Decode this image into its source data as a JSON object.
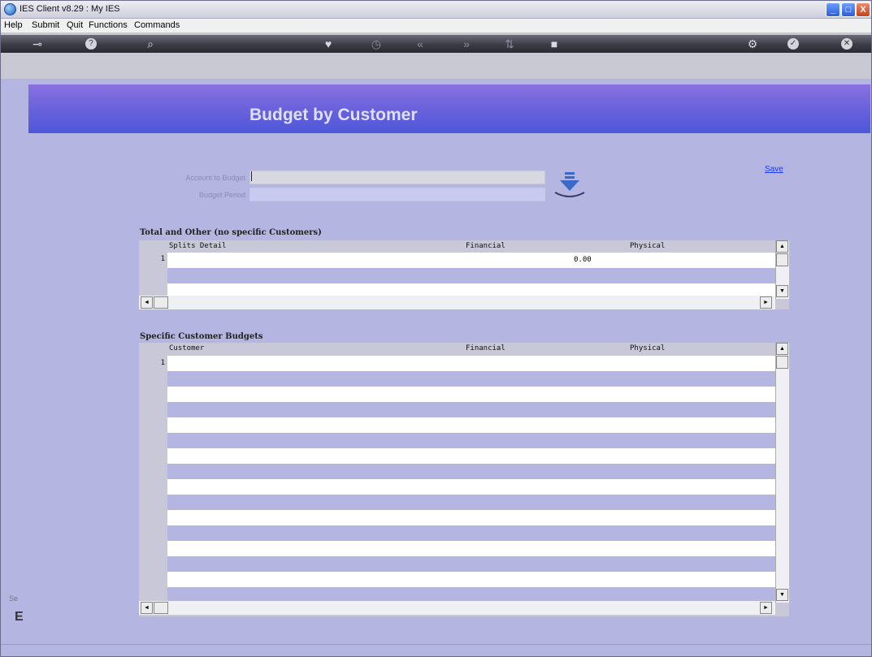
{
  "window": {
    "title": "IES Client v8.29 : My IES",
    "min": "_",
    "max": "□",
    "close": "X"
  },
  "menu": [
    "Help",
    "Submit",
    "Quit",
    "Functions",
    "Commands"
  ],
  "toolbar": {
    "key": "⊸",
    "help": "?",
    "search": "⌕",
    "heart": "♥",
    "history": "◷",
    "prev": "«",
    "next": "»",
    "stack": "⇅",
    "stop": "■",
    "settings": "⚙",
    "ok": "✓",
    "cancel": "✕"
  },
  "page": {
    "title": "Budget by Customer",
    "save_label": "Save"
  },
  "form": {
    "account_label": "Account to Budget",
    "account_value": "",
    "period_label": "Budget Period",
    "period_value": ""
  },
  "totals_section": {
    "title": "Total and Other (no specific Customers)",
    "columns": [
      "Splits Detail",
      "Financial",
      "Physical"
    ],
    "rows": [
      {
        "num": "1",
        "detail": "",
        "financial": "0.00",
        "physical": ""
      }
    ]
  },
  "customers_section": {
    "title": "Specific Customer Budgets",
    "columns": [
      "Customer",
      "Financial",
      "Physical"
    ],
    "rows": [
      {
        "num": "1",
        "customer": "",
        "financial": "",
        "physical": ""
      }
    ]
  },
  "scroll": {
    "up": "▲",
    "down": "▼",
    "left": "◄",
    "right": "►"
  },
  "side": {
    "label": "Se",
    "glyph": "E"
  },
  "colors": {
    "background": "#b4b5e0",
    "banner": "#6a62dc",
    "link": "#1a3aff"
  }
}
